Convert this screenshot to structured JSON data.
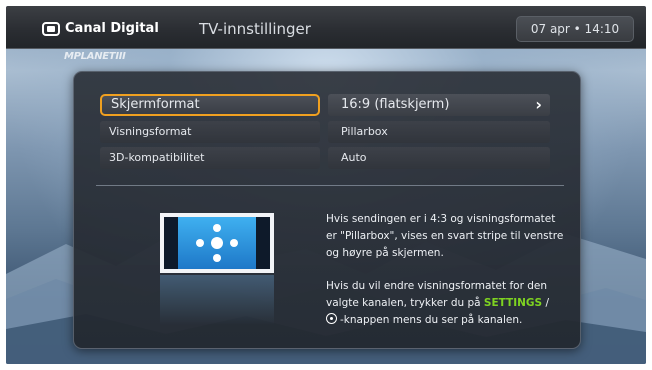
{
  "header": {
    "brand": "Canal Digital",
    "title": "TV-innstillinger",
    "clock": "07 apr • 14:10",
    "channel_watermark": "MPLANETIII"
  },
  "settings": [
    {
      "label": "Skjermformat",
      "value": "16:9 (flatskjerm)",
      "selected": true,
      "has_arrow": true
    },
    {
      "label": "Visningsformat",
      "value": "Pillarbox",
      "selected": false
    },
    {
      "label": "3D-kompatibilitet",
      "value": "Auto",
      "selected": false
    }
  ],
  "help": {
    "para1": "Hvis sendingen er i 4:3 og visningsformatet er \"Pillarbox\", vises en svart stripe til venstre og høyre på skjermen.",
    "para2_prefix": "Hvis du vil endre visningsformatet for den valgte kanalen, trykker du på ",
    "settings_key": "SETTINGS",
    "para2_sep": " / ",
    "para2_suffix": "-knappen mens du ser på kanalen."
  },
  "colors": {
    "accent_focus": "#f0a020",
    "settings_key": "#7ed321",
    "illustration_blue": "#1e8ee0"
  },
  "icons": {
    "brand": "tv-icon",
    "arrow": "chevron-right-icon",
    "button": "circle-dot-icon"
  }
}
